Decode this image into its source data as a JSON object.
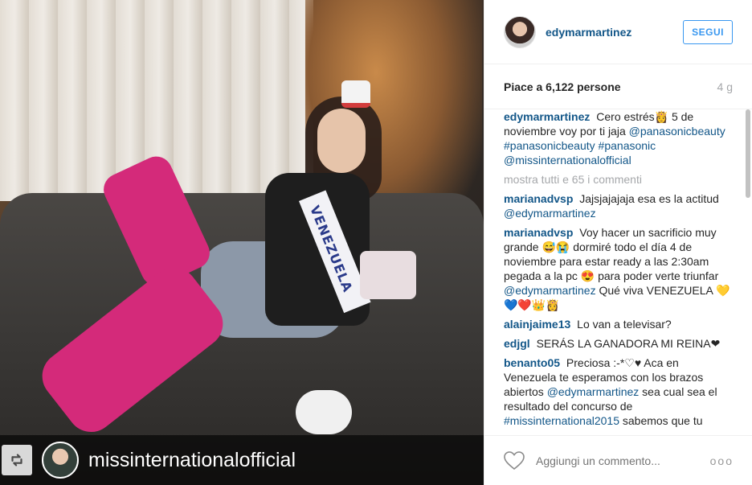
{
  "post": {
    "repost_username": "missinternationalofficial",
    "sash_text": "VENEZUELA"
  },
  "header": {
    "username": "edymarmartinez",
    "follow_label": "SEGUI"
  },
  "meta": {
    "likes": "Piace a 6,122 persone",
    "time": "4 g"
  },
  "caption": {
    "username": "edymarmartinez",
    "text_1": "Cero estrés👸 5 de noviembre voy por ti jaja",
    "tag_1": "@panasonicbeauty",
    "tag_2": "#panasonicbeauty",
    "tag_3": "#panasonic",
    "tag_4": "@missinternationalofficial"
  },
  "show_all": "mostra tutti e 65 i commenti",
  "comments": [
    {
      "user": "marianadvsp",
      "text": "Jajsjajajaja esa es la actitud",
      "mention": "@edymarmartinez",
      "text_after": ""
    },
    {
      "user": "marianadvsp",
      "text": "Voy hacer un sacrificio muy grande 😅😭 dormiré todo el día 4 de noviembre para estar ready a las 2:30am pegada a la pc 😍 para poder verte triunfar",
      "mention": "@edymarmartinez",
      "text_after": "Qué viva VENEZUELA 💛💙❤️👑👸"
    },
    {
      "user": "alainjaime13",
      "text": "Lo van a televisar?",
      "mention": "",
      "text_after": ""
    },
    {
      "user": "edjgl",
      "text": "SERÁS LA GANADORA MI REINA❤",
      "mention": "",
      "text_after": ""
    },
    {
      "user": "benanto05",
      "text": "Preciosa :-*♡♥ Aca en Venezuela te esperamos con los brazos abiertos",
      "mention": "@edymarmartinez",
      "text_after": "sea cual sea el resultado del concurso de",
      "hashtag": "#missinternational2015",
      "text_end": "sabemos que tu"
    }
  ],
  "footer": {
    "comment_placeholder": "Aggiungi un commento...",
    "more_label": "ooo"
  },
  "icons": {
    "repost": "repost-icon",
    "heart": "heart-icon",
    "more": "more-options-icon"
  }
}
